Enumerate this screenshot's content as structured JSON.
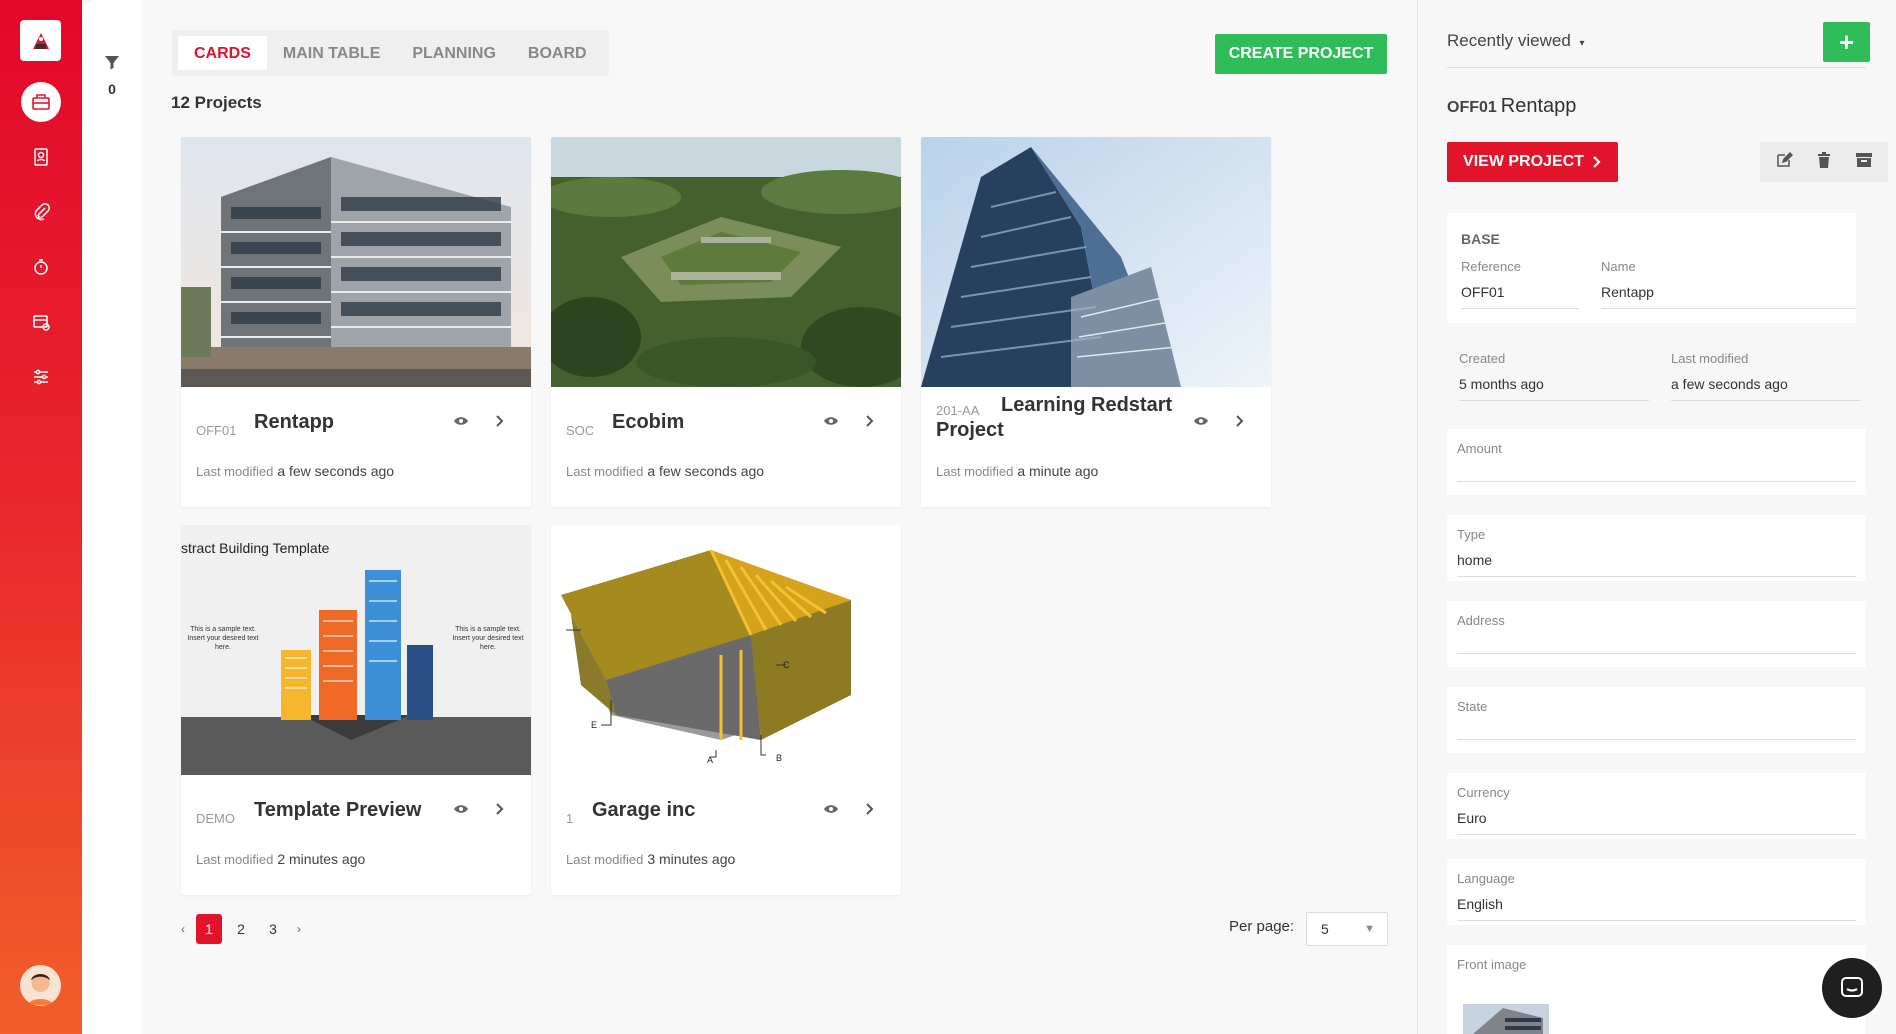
{
  "sidebar": {
    "icons": [
      "logo-icon",
      "projects-icon",
      "contacts-icon",
      "attachments-icon",
      "timer-icon",
      "reports-icon",
      "settings-icon"
    ]
  },
  "filter": {
    "count": "0"
  },
  "tabs": [
    {
      "label": "CARDS",
      "active": true
    },
    {
      "label": "MAIN TABLE"
    },
    {
      "label": "PLANNING"
    },
    {
      "label": "BOARD"
    }
  ],
  "create_label": "CREATE PROJECT",
  "project_count": "12 Projects",
  "last_modified_label": "Last modified",
  "cards": [
    {
      "ref": "OFF01",
      "title": "Rentapp",
      "modified": "a few seconds ago"
    },
    {
      "ref": "SOC",
      "title": "Ecobim",
      "modified": "a few seconds ago"
    },
    {
      "ref": "201-AA",
      "title": "Learning Redstart Project",
      "modified": "a minute ago"
    },
    {
      "ref": "DEMO",
      "title": "Template Preview",
      "modified": "2 minutes ago"
    },
    {
      "ref": "1",
      "title": "Garage inc",
      "modified": "3 minutes ago"
    }
  ],
  "template_image": {
    "heading": "stract Building Template",
    "left_text": "This is a sample text. Insert your desired text here.",
    "right_text": "This is a sample text. Insert your desired text here."
  },
  "garage_image": {
    "labels": [
      "A",
      "B",
      "C",
      "E"
    ]
  },
  "pagination": {
    "prev": "‹",
    "pages": [
      "1",
      "2",
      "3"
    ],
    "next": "›",
    "current": "1"
  },
  "per_page": {
    "label": "Per page:",
    "value": "5"
  },
  "panel": {
    "recent_label": "Recently viewed",
    "add_label": "+",
    "ref": "OFF01",
    "name": "Rentapp",
    "view_label": "VIEW PROJECT",
    "base_heading": "BASE",
    "fields": {
      "reference": {
        "label": "Reference",
        "value": "OFF01"
      },
      "name": {
        "label": "Name",
        "value": "Rentapp"
      },
      "created": {
        "label": "Created",
        "value": "5 months ago"
      },
      "last_modified": {
        "label": "Last modified",
        "value": "a few seconds ago"
      },
      "amount": {
        "label": "Amount",
        "value": ""
      },
      "type": {
        "label": "Type",
        "value": "home"
      },
      "address": {
        "label": "Address",
        "value": ""
      },
      "state": {
        "label": "State",
        "value": ""
      },
      "currency": {
        "label": "Currency",
        "value": "Euro"
      },
      "language": {
        "label": "Language",
        "value": "English"
      },
      "front_image": {
        "label": "Front image"
      }
    }
  },
  "colors": {
    "brand_red": "#e2142c",
    "green": "#2ebd59"
  }
}
